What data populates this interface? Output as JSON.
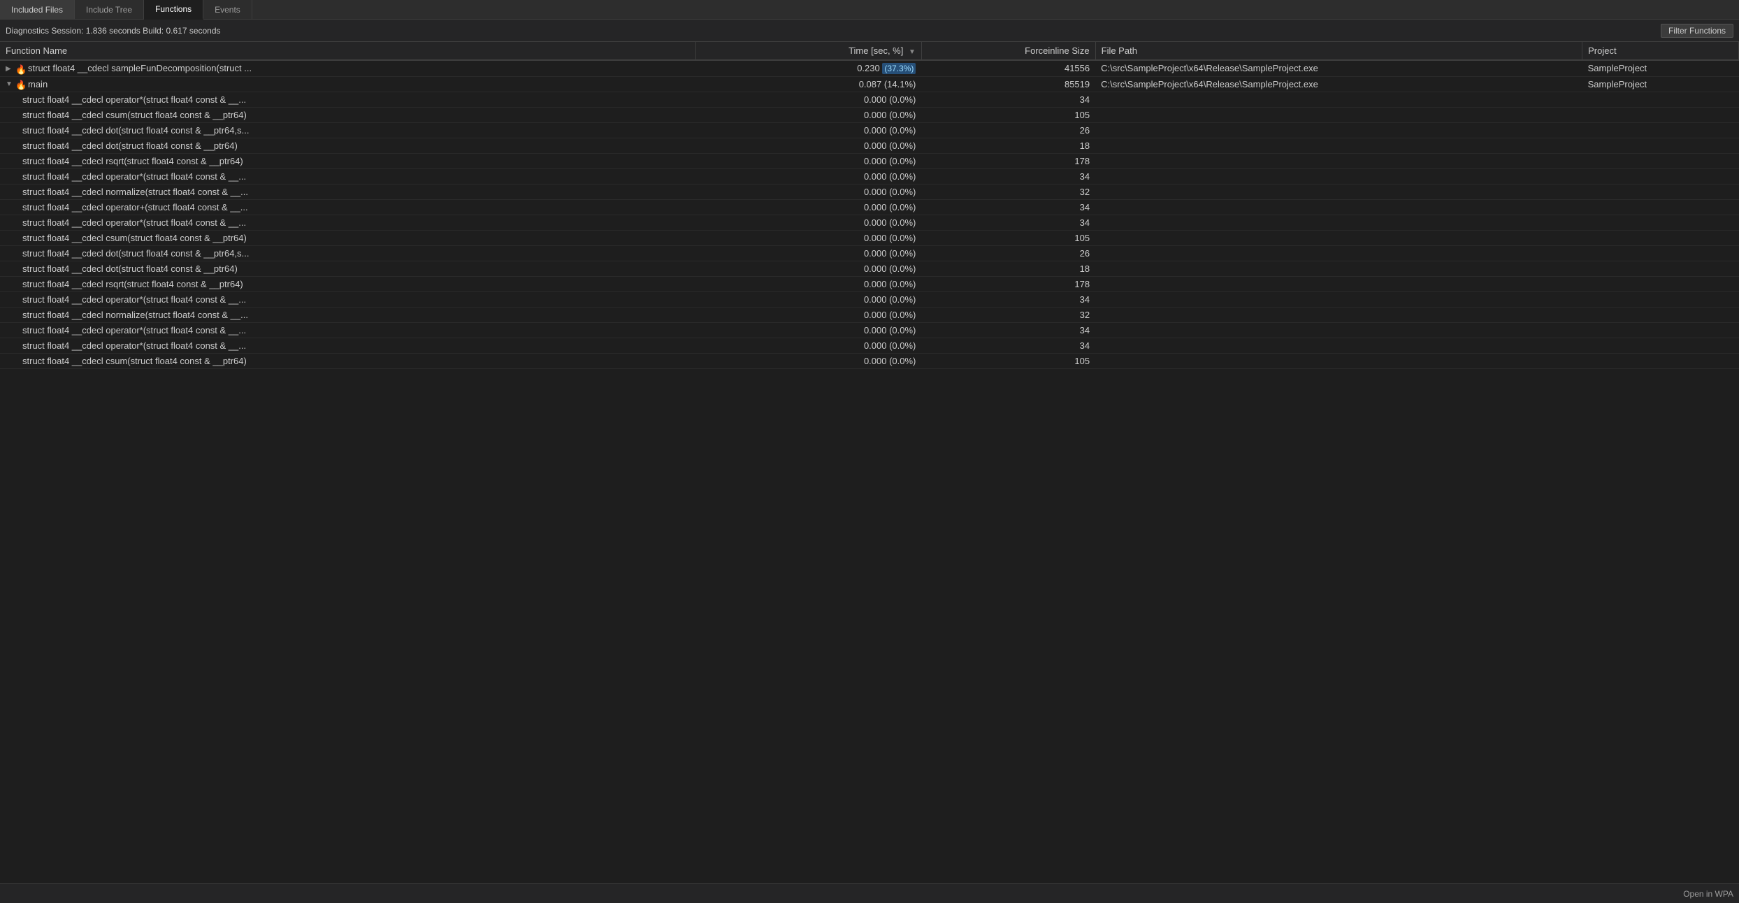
{
  "tabs": [
    {
      "id": "included-files",
      "label": "Included Files",
      "active": false
    },
    {
      "id": "include-tree",
      "label": "Include Tree",
      "active": false
    },
    {
      "id": "functions",
      "label": "Functions",
      "active": true
    },
    {
      "id": "events",
      "label": "Events",
      "active": false
    }
  ],
  "status": {
    "text": "Diagnostics Session: 1.836 seconds  Build: 0.617 seconds"
  },
  "filter_button": "Filter Functions",
  "columns": [
    {
      "id": "name",
      "label": "Function Name",
      "sortable": false
    },
    {
      "id": "time",
      "label": "Time [sec, %]",
      "sortable": true,
      "sorted": "desc"
    },
    {
      "id": "inline",
      "label": "Forceinline Size",
      "sortable": false
    },
    {
      "id": "path",
      "label": "File Path",
      "sortable": false
    },
    {
      "id": "project",
      "label": "Project",
      "sortable": false
    }
  ],
  "rows": [
    {
      "type": "parent",
      "expandable": true,
      "expanded": false,
      "fire": true,
      "name": "struct float4 __cdecl sampleFunDecomposition(struct ...",
      "time": "0.230",
      "pct": "37.3%",
      "pct_highlight": true,
      "inline_size": "41556",
      "path": "C:\\src\\SampleProject\\x64\\Release\\SampleProject.exe",
      "project": "SampleProject"
    },
    {
      "type": "parent",
      "expandable": true,
      "expanded": true,
      "fire": true,
      "name": "main",
      "time": "0.087",
      "pct": "14.1%",
      "pct_highlight": false,
      "inline_size": "85519",
      "path": "C:\\src\\SampleProject\\x64\\Release\\SampleProject.exe",
      "project": "SampleProject"
    },
    {
      "type": "child",
      "name": "struct float4 __cdecl operator*(struct float4 const & __...",
      "time": "0.000",
      "pct": "0.0%",
      "inline_size": "34",
      "path": "",
      "project": ""
    },
    {
      "type": "child",
      "name": "struct float4 __cdecl csum(struct float4 const & __ptr64)",
      "time": "0.000",
      "pct": "0.0%",
      "inline_size": "105",
      "path": "",
      "project": ""
    },
    {
      "type": "child",
      "name": "struct float4 __cdecl dot(struct float4 const & __ptr64,s...",
      "time": "0.000",
      "pct": "0.0%",
      "inline_size": "26",
      "path": "",
      "project": ""
    },
    {
      "type": "child",
      "name": "struct float4 __cdecl dot(struct float4 const & __ptr64)",
      "time": "0.000",
      "pct": "0.0%",
      "inline_size": "18",
      "path": "",
      "project": ""
    },
    {
      "type": "child",
      "name": "struct float4 __cdecl rsqrt(struct float4 const & __ptr64)",
      "time": "0.000",
      "pct": "0.0%",
      "inline_size": "178",
      "path": "",
      "project": ""
    },
    {
      "type": "child",
      "name": "struct float4 __cdecl operator*(struct float4 const & __...",
      "time": "0.000",
      "pct": "0.0%",
      "inline_size": "34",
      "path": "",
      "project": ""
    },
    {
      "type": "child",
      "name": "struct float4 __cdecl normalize(struct float4 const & __...",
      "time": "0.000",
      "pct": "0.0%",
      "inline_size": "32",
      "path": "",
      "project": ""
    },
    {
      "type": "child",
      "name": "struct float4 __cdecl operator+(struct float4 const & __...",
      "time": "0.000",
      "pct": "0.0%",
      "inline_size": "34",
      "path": "",
      "project": ""
    },
    {
      "type": "child",
      "name": "struct float4 __cdecl operator*(struct float4 const & __...",
      "time": "0.000",
      "pct": "0.0%",
      "inline_size": "34",
      "path": "",
      "project": ""
    },
    {
      "type": "child",
      "name": "struct float4 __cdecl csum(struct float4 const & __ptr64)",
      "time": "0.000",
      "pct": "0.0%",
      "inline_size": "105",
      "path": "",
      "project": ""
    },
    {
      "type": "child",
      "name": "struct float4 __cdecl dot(struct float4 const & __ptr64,s...",
      "time": "0.000",
      "pct": "0.0%",
      "inline_size": "26",
      "path": "",
      "project": ""
    },
    {
      "type": "child",
      "name": "struct float4 __cdecl dot(struct float4 const & __ptr64)",
      "time": "0.000",
      "pct": "0.0%",
      "inline_size": "18",
      "path": "",
      "project": ""
    },
    {
      "type": "child",
      "name": "struct float4 __cdecl rsqrt(struct float4 const & __ptr64)",
      "time": "0.000",
      "pct": "0.0%",
      "inline_size": "178",
      "path": "",
      "project": ""
    },
    {
      "type": "child",
      "name": "struct float4 __cdecl operator*(struct float4 const & __...",
      "time": "0.000",
      "pct": "0.0%",
      "inline_size": "34",
      "path": "",
      "project": ""
    },
    {
      "type": "child",
      "name": "struct float4 __cdecl normalize(struct float4 const & __...",
      "time": "0.000",
      "pct": "0.0%",
      "inline_size": "32",
      "path": "",
      "project": ""
    },
    {
      "type": "child",
      "name": "struct float4 __cdecl operator*(struct float4 const & __...",
      "time": "0.000",
      "pct": "0.0%",
      "inline_size": "34",
      "path": "",
      "project": ""
    },
    {
      "type": "child",
      "name": "struct float4 __cdecl operator*(struct float4 const & __...",
      "time": "0.000",
      "pct": "0.0%",
      "inline_size": "34",
      "path": "",
      "project": ""
    },
    {
      "type": "child",
      "name": "struct float4 __cdecl csum(struct float4 const & __ptr64)",
      "time": "0.000",
      "pct": "0.0%",
      "inline_size": "105",
      "path": "",
      "project": ""
    }
  ],
  "bottom_bar": {
    "open_wpa_label": "Open in WPA"
  }
}
